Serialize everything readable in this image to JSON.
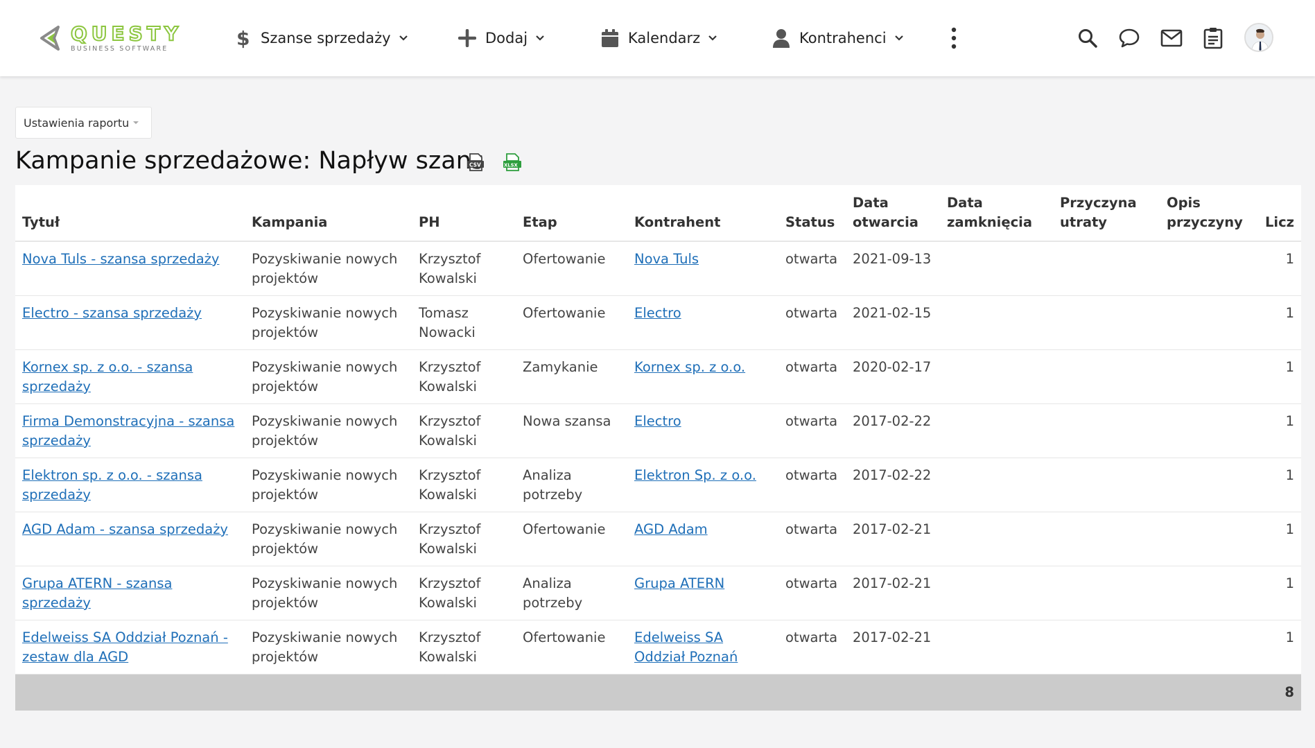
{
  "header": {
    "logo_word": "QUESTY",
    "logo_sub": "BUSINESS SOFTWARE",
    "nav": [
      {
        "label": "Szanse sprzedaży",
        "icon": "dollar-icon"
      },
      {
        "label": "Dodaj",
        "icon": "plus-icon"
      },
      {
        "label": "Kalendarz",
        "icon": "calendar-icon"
      },
      {
        "label": "Kontrahenci",
        "icon": "user-icon"
      }
    ],
    "tools": [
      "search-icon",
      "chat-icon",
      "mail-icon",
      "clipboard-icon"
    ]
  },
  "report": {
    "settings_label": "Ustawienia raportu",
    "title": "Kampanie sprzedażowe: Napływ szans",
    "export_icons": [
      "csv-export-icon",
      "xlsx-export-icon"
    ],
    "columns": [
      "Tytuł",
      "Kampania",
      "PH",
      "Etap",
      "Kontrahent",
      "Status",
      "Data otwarcia",
      "Data zamknięcia",
      "Przyczyna utraty",
      "Opis przyczyny",
      "Licz"
    ],
    "rows": [
      {
        "tytul": "Nova Tuls - szansa sprzedaży",
        "kampania": "Pozyskiwanie nowych projektów",
        "ph": "Krzysztof Kowalski",
        "etap": "Ofertowanie",
        "kontrahent": "Nova Tuls",
        "status": "otwarta",
        "data_otwarcia": "2021-09-13",
        "data_zamkniecia": "",
        "przyczyna": "",
        "opis": "",
        "licz": "1"
      },
      {
        "tytul": "Electro - szansa sprzedaży",
        "kampania": "Pozyskiwanie nowych projektów",
        "ph": "Tomasz Nowacki",
        "etap": "Ofertowanie",
        "kontrahent": "Electro",
        "status": "otwarta",
        "data_otwarcia": "2021-02-15",
        "data_zamkniecia": "",
        "przyczyna": "",
        "opis": "",
        "licz": "1"
      },
      {
        "tytul": "Kornex sp. z o.o. - szansa sprzedaży",
        "kampania": "Pozyskiwanie nowych projektów",
        "ph": "Krzysztof Kowalski",
        "etap": "Zamykanie",
        "kontrahent": "Kornex sp. z o.o.",
        "status": "otwarta",
        "data_otwarcia": "2020-02-17",
        "data_zamkniecia": "",
        "przyczyna": "",
        "opis": "",
        "licz": "1"
      },
      {
        "tytul": "Firma Demonstracyjna - szansa sprzedaży",
        "kampania": "Pozyskiwanie nowych projektów",
        "ph": "Krzysztof Kowalski",
        "etap": "Nowa szansa",
        "kontrahent": "Electro",
        "status": "otwarta",
        "data_otwarcia": "2017-02-22",
        "data_zamkniecia": "",
        "przyczyna": "",
        "opis": "",
        "licz": "1"
      },
      {
        "tytul": "Elektron sp. z o.o. - szansa sprzedaży",
        "kampania": "Pozyskiwanie nowych projektów",
        "ph": "Krzysztof Kowalski",
        "etap": "Analiza potrzeby",
        "kontrahent": "Elektron Sp. z o.o.",
        "status": "otwarta",
        "data_otwarcia": "2017-02-22",
        "data_zamkniecia": "",
        "przyczyna": "",
        "opis": "",
        "licz": "1"
      },
      {
        "tytul": "AGD Adam - szansa sprzedaży",
        "kampania": "Pozyskiwanie nowych projektów",
        "ph": "Krzysztof Kowalski",
        "etap": "Ofertowanie",
        "kontrahent": "AGD Adam",
        "status": "otwarta",
        "data_otwarcia": "2017-02-21",
        "data_zamkniecia": "",
        "przyczyna": "",
        "opis": "",
        "licz": "1"
      },
      {
        "tytul": "Grupa ATERN - szansa sprzedaży",
        "kampania": "Pozyskiwanie nowych projektów",
        "ph": "Krzysztof Kowalski",
        "etap": "Analiza potrzeby",
        "kontrahent": "Grupa ATERN",
        "status": "otwarta",
        "data_otwarcia": "2017-02-21",
        "data_zamkniecia": "",
        "przyczyna": "",
        "opis": "",
        "licz": "1"
      },
      {
        "tytul": "Edelweiss SA Oddział Poznań - zestaw dla AGD",
        "kampania": "Pozyskiwanie nowych projektów",
        "ph": "Krzysztof Kowalski",
        "etap": "Ofertowanie",
        "kontrahent": "Edelweiss SA Oddział Poznań",
        "status": "otwarta",
        "data_otwarcia": "2017-02-21",
        "data_zamkniecia": "",
        "przyczyna": "",
        "opis": "",
        "licz": "1"
      }
    ],
    "total": "8"
  },
  "colors": {
    "link": "#1f6fb8",
    "logo_green": "#8cc63f",
    "footer_bg": "#cbcbcb",
    "xlsx_green": "#2e9e3e"
  }
}
